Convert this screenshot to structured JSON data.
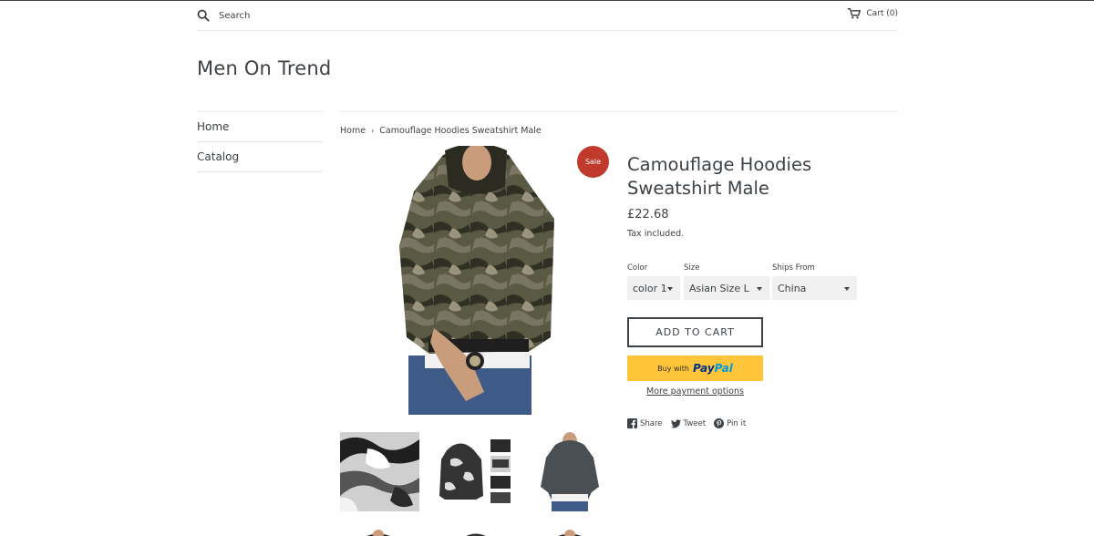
{
  "header": {
    "search_placeholder": "Search",
    "cart_label": "Cart (0)"
  },
  "site_title": "Men On Trend",
  "sidebar": {
    "items": [
      {
        "label": "Home"
      },
      {
        "label": "Catalog"
      }
    ]
  },
  "breadcrumb": {
    "home": "Home",
    "current": "Camouflage Hoodies Sweatshirt Male"
  },
  "product": {
    "sale_badge": "Sale",
    "title": "Camouflage Hoodies Sweatshirt Male",
    "price": "£22.68",
    "tax_note": "Tax included.",
    "options": [
      {
        "label": "Color",
        "value": "color 1"
      },
      {
        "label": "Size",
        "value": "Asian Size L"
      },
      {
        "label": "Ships From",
        "value": "China"
      }
    ],
    "add_to_cart": "ADD TO CART",
    "paypal_prefix": "Buy with",
    "paypal_word1": "Pay",
    "paypal_word2": "Pal",
    "more_payment": "More payment options"
  },
  "social": {
    "share": "Share",
    "tweet": "Tweet",
    "pin": "Pin it"
  },
  "colors": {
    "text": "#3d4246",
    "sale": "#c0392b",
    "paypal": "#ffc439",
    "border": "#e8e9eb"
  }
}
